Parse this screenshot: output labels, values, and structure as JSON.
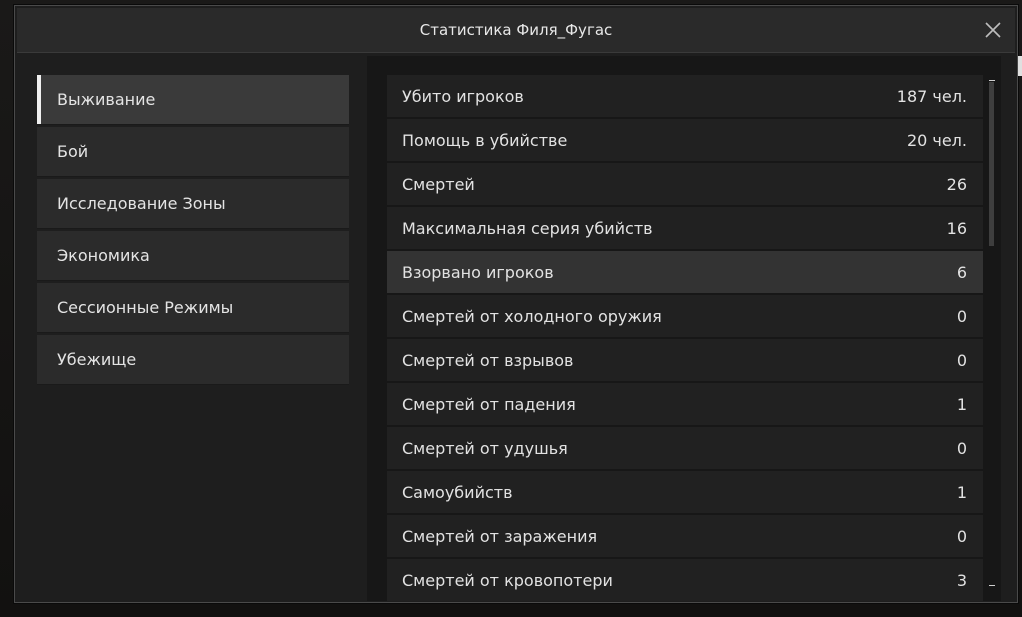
{
  "dialog": {
    "title": "Статистика Филя_Фугас",
    "close_icon": "close-icon"
  },
  "sidebar": {
    "items": [
      {
        "label": "Выживание",
        "active": true
      },
      {
        "label": "Бой",
        "active": false
      },
      {
        "label": "Исследование Зоны",
        "active": false
      },
      {
        "label": "Экономика",
        "active": false
      },
      {
        "label": "Сессионные Режимы",
        "active": false
      },
      {
        "label": "Убежище",
        "active": false
      }
    ]
  },
  "stats": [
    {
      "label": "Убито игроков",
      "value": "187 чел."
    },
    {
      "label": "Помощь в убийстве",
      "value": "20 чел."
    },
    {
      "label": "Смертей",
      "value": "26"
    },
    {
      "label": "Максимальная серия убийств",
      "value": "16"
    },
    {
      "label": "Взорвано игроков",
      "value": "6"
    },
    {
      "label": "Смертей от холодного оружия",
      "value": "0"
    },
    {
      "label": "Смертей от взрывов",
      "value": "0"
    },
    {
      "label": "Смертей от падения",
      "value": "1"
    },
    {
      "label": "Смертей от удушья",
      "value": "0"
    },
    {
      "label": "Самоубийств",
      "value": "1"
    },
    {
      "label": "Смертей от заражения",
      "value": "0"
    },
    {
      "label": "Смертей от кровопотери",
      "value": "3"
    }
  ],
  "colors": {
    "panel_bg": "#1e1e1e",
    "row_bg": "#212121",
    "row_hover_bg": "#333333",
    "accent": "#f0f0f0"
  }
}
